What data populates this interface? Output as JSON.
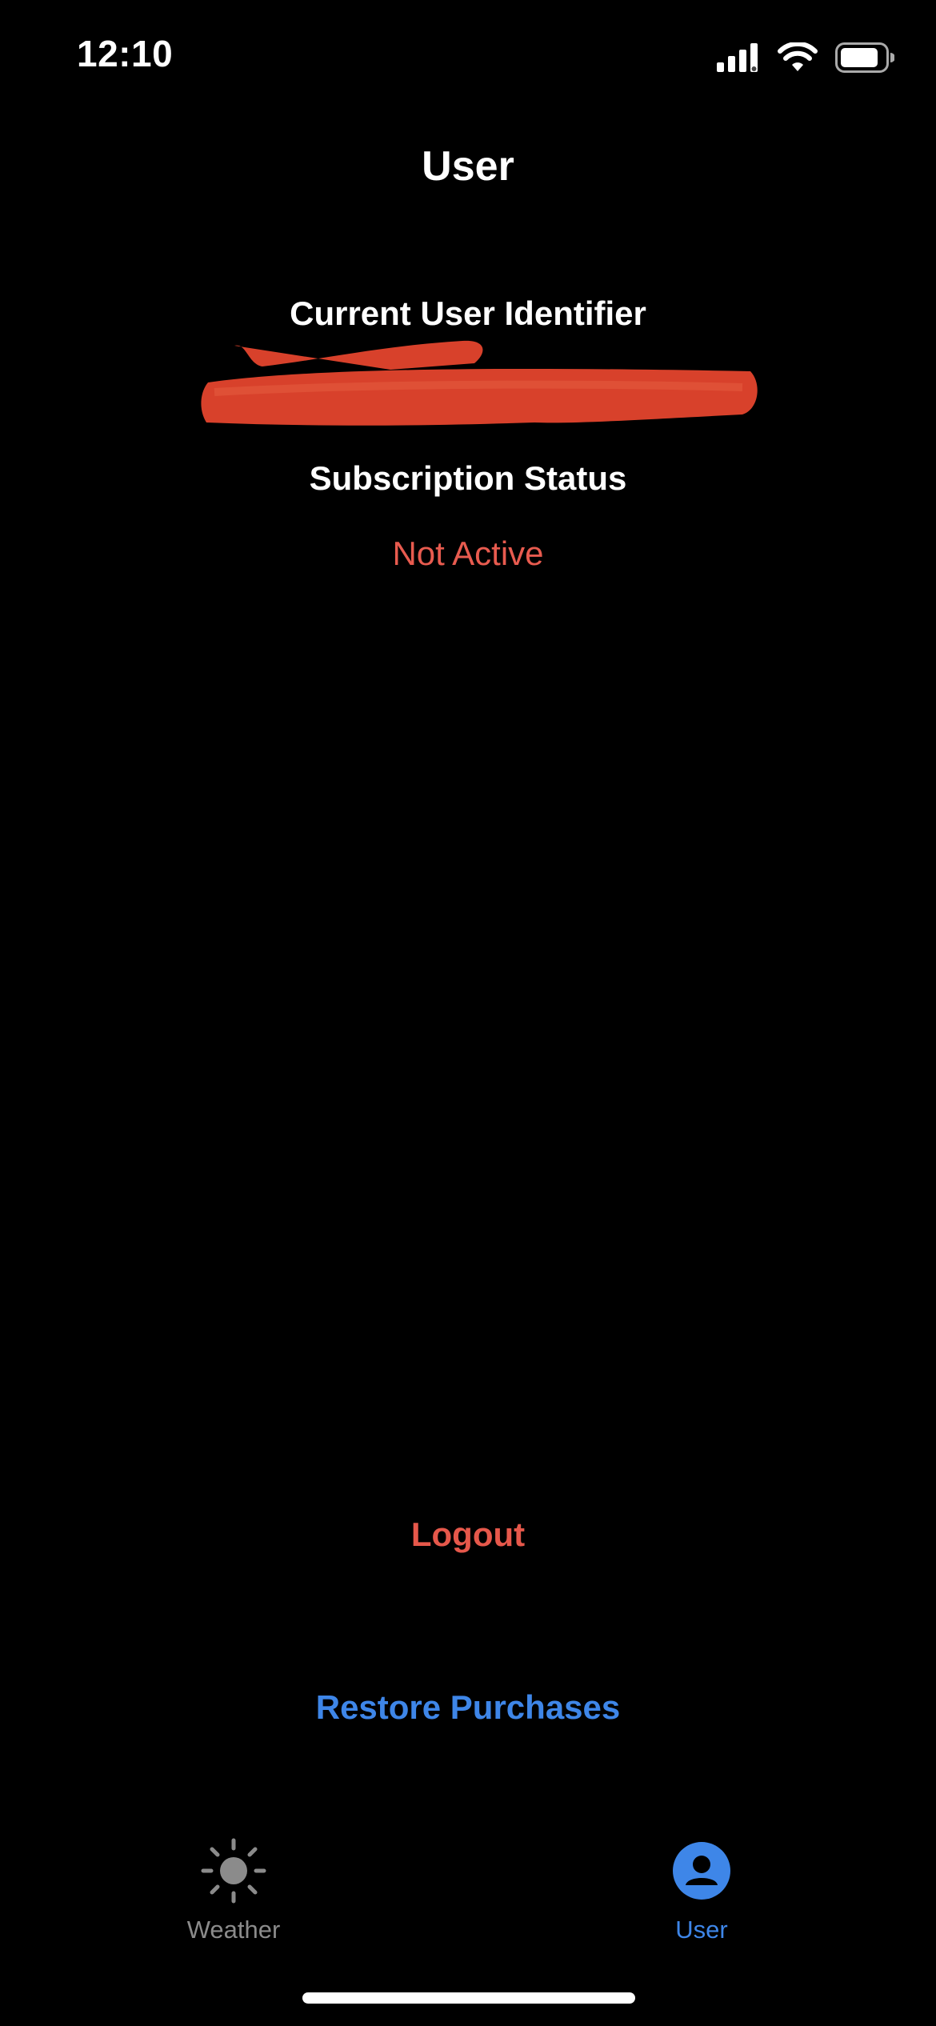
{
  "status_bar": {
    "time": "12:10",
    "icons": [
      "cellular-signal-icon",
      "wifi-icon",
      "battery-icon"
    ]
  },
  "nav": {
    "title": "User"
  },
  "user_identifier": {
    "label": "Current User Identifier",
    "value": ""
  },
  "subscription": {
    "label": "Subscription Status",
    "value": "Not Active"
  },
  "actions": {
    "logout_label": "Logout",
    "restore_label": "Restore Purchases"
  },
  "tab_bar": {
    "tabs": [
      {
        "label": "Weather",
        "icon": "sun-icon",
        "selected": false
      },
      {
        "label": "User",
        "icon": "person-icon",
        "selected": true
      }
    ]
  },
  "colors": {
    "background": "#000000",
    "destructive": "#E6584B",
    "accent": "#3E86E8",
    "inactive": "#8B8B8B"
  }
}
